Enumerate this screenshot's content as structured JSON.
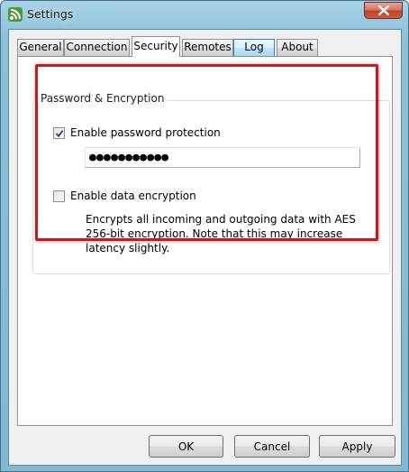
{
  "window": {
    "title": "Settings",
    "app_icon": "rss-feed-icon",
    "close_icon": "close-icon"
  },
  "tabs": [
    {
      "label": "General",
      "selected": false
    },
    {
      "label": "Connection",
      "selected": false
    },
    {
      "label": "Security",
      "selected": true
    },
    {
      "label": "Remotes",
      "selected": false
    },
    {
      "label": "Log",
      "selected": false
    },
    {
      "label": "About",
      "selected": false
    }
  ],
  "security": {
    "group_title": "Password & Encryption",
    "password_protection": {
      "label": "Enable password protection",
      "checked": true,
      "value": "●●●●●●●●●●●"
    },
    "data_encryption": {
      "label": "Enable data encryption",
      "checked": false,
      "description": "Encrypts all incoming and outgoing data with AES 256-bit encryption. Note that this may increase latency slightly."
    }
  },
  "buttons": {
    "ok": "OK",
    "cancel": "Cancel",
    "apply": "Apply"
  },
  "colors": {
    "highlight_border": "#d0161d",
    "title_bar": "#8cc0d9",
    "close_button": "#c0412a"
  }
}
